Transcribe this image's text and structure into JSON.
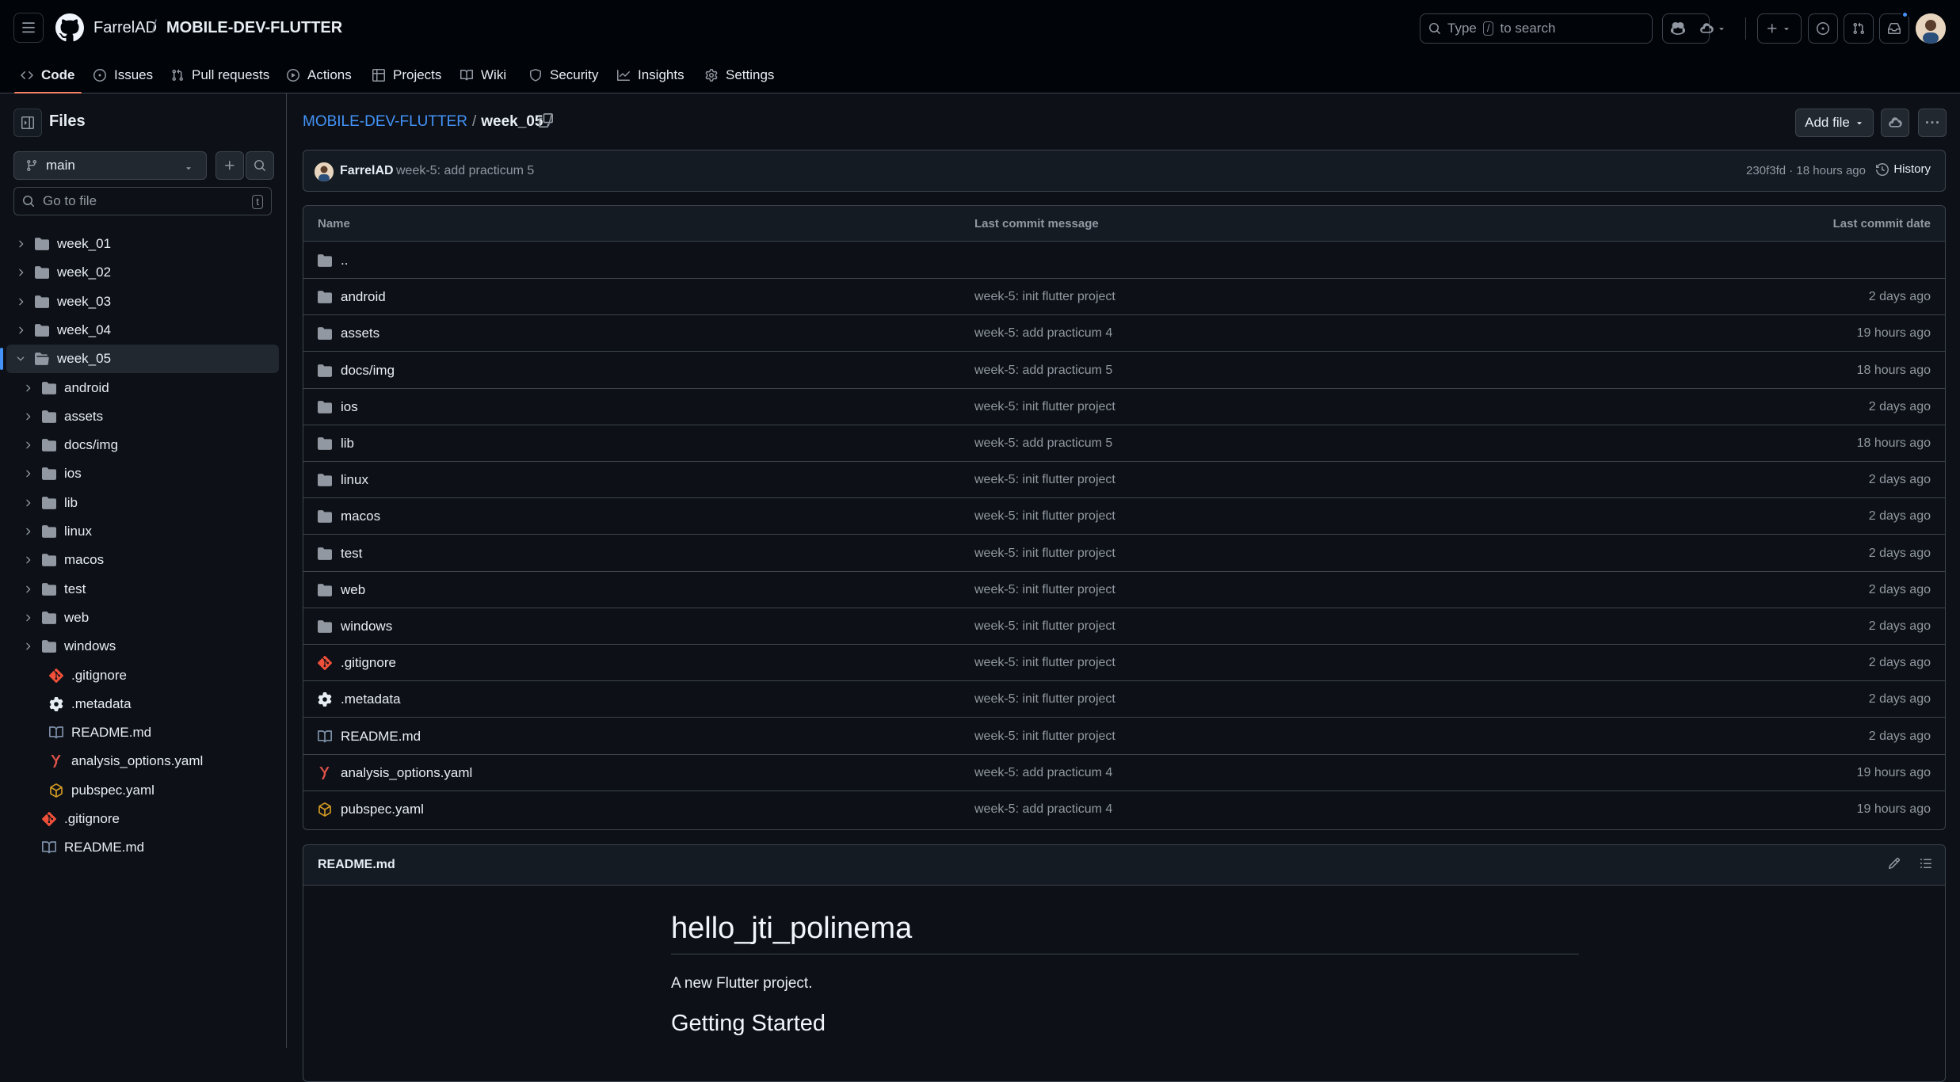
{
  "header": {
    "owner": "FarrelAD",
    "separator": "/",
    "repo": "MOBILE-DEV-FLUTTER",
    "search": {
      "prefix": "Type",
      "key": "/",
      "suffix": "to search"
    }
  },
  "tabs": [
    {
      "label": "Code",
      "icon": "code-icon",
      "active": true
    },
    {
      "label": "Issues",
      "icon": "issue-opened-icon"
    },
    {
      "label": "Pull requests",
      "icon": "git-pull-request-icon"
    },
    {
      "label": "Actions",
      "icon": "play-icon"
    },
    {
      "label": "Projects",
      "icon": "table-icon"
    },
    {
      "label": "Wiki",
      "icon": "book-icon"
    },
    {
      "label": "Security",
      "icon": "shield-icon"
    },
    {
      "label": "Insights",
      "icon": "graph-icon"
    },
    {
      "label": "Settings",
      "icon": "gear-icon"
    }
  ],
  "sidebar": {
    "title": "Files",
    "branch": "main",
    "goto_placeholder": "Go to file",
    "goto_key": "t",
    "tree": [
      {
        "label": "week_01",
        "type": "folder",
        "depth": 0
      },
      {
        "label": "week_02",
        "type": "folder",
        "depth": 0
      },
      {
        "label": "week_03",
        "type": "folder",
        "depth": 0
      },
      {
        "label": "week_04",
        "type": "folder",
        "depth": 0
      },
      {
        "label": "week_05",
        "type": "folder-open",
        "depth": 0,
        "selected": true
      },
      {
        "label": "android",
        "type": "folder",
        "depth": 1
      },
      {
        "label": "assets",
        "type": "folder",
        "depth": 1
      },
      {
        "label": "docs/img",
        "type": "folder",
        "depth": 1
      },
      {
        "label": "ios",
        "type": "folder",
        "depth": 1
      },
      {
        "label": "lib",
        "type": "folder",
        "depth": 1
      },
      {
        "label": "linux",
        "type": "folder",
        "depth": 1
      },
      {
        "label": "macos",
        "type": "folder",
        "depth": 1
      },
      {
        "label": "test",
        "type": "folder",
        "depth": 1
      },
      {
        "label": "web",
        "type": "folder",
        "depth": 1
      },
      {
        "label": "windows",
        "type": "folder",
        "depth": 1
      },
      {
        "label": ".gitignore",
        "type": "git",
        "depth": 1
      },
      {
        "label": ".metadata",
        "type": "gear",
        "depth": 1
      },
      {
        "label": "README.md",
        "type": "book",
        "depth": 1
      },
      {
        "label": "analysis_options.yaml",
        "type": "yaml",
        "depth": 1
      },
      {
        "label": "pubspec.yaml",
        "type": "package",
        "depth": 1
      },
      {
        "label": ".gitignore",
        "type": "git",
        "depth": 0
      },
      {
        "label": "README.md",
        "type": "book",
        "depth": 0
      }
    ]
  },
  "main": {
    "breadcrumb": {
      "repo": "MOBILE-DEV-FLUTTER",
      "folder": "week_05",
      "sep": "/"
    },
    "add_file": "Add file",
    "commit": {
      "author": "FarrelAD",
      "message": "week-5: add practicum 5",
      "meta": "230f3fd · 18 hours ago",
      "history": "History"
    },
    "columns": {
      "name": "Name",
      "message": "Last commit message",
      "date": "Last commit date"
    },
    "files": [
      {
        "name": "..",
        "type": "folder",
        "message": "",
        "date": ""
      },
      {
        "name": "android",
        "type": "folder",
        "message": "week-5: init flutter project",
        "date": "2 days ago"
      },
      {
        "name": "assets",
        "type": "folder",
        "message": "week-5: add practicum 4",
        "date": "19 hours ago"
      },
      {
        "name": "docs/img",
        "type": "folder",
        "message": "week-5: add practicum 5",
        "date": "18 hours ago"
      },
      {
        "name": "ios",
        "type": "folder",
        "message": "week-5: init flutter project",
        "date": "2 days ago"
      },
      {
        "name": "lib",
        "type": "folder",
        "message": "week-5: add practicum 5",
        "date": "18 hours ago"
      },
      {
        "name": "linux",
        "type": "folder",
        "message": "week-5: init flutter project",
        "date": "2 days ago"
      },
      {
        "name": "macos",
        "type": "folder",
        "message": "week-5: init flutter project",
        "date": "2 days ago"
      },
      {
        "name": "test",
        "type": "folder",
        "message": "week-5: init flutter project",
        "date": "2 days ago"
      },
      {
        "name": "web",
        "type": "folder",
        "message": "week-5: init flutter project",
        "date": "2 days ago"
      },
      {
        "name": "windows",
        "type": "folder",
        "message": "week-5: init flutter project",
        "date": "2 days ago"
      },
      {
        "name": ".gitignore",
        "type": "git",
        "message": "week-5: init flutter project",
        "date": "2 days ago"
      },
      {
        "name": ".metadata",
        "type": "gear",
        "message": "week-5: init flutter project",
        "date": "2 days ago"
      },
      {
        "name": "README.md",
        "type": "book",
        "message": "week-5: init flutter project",
        "date": "2 days ago"
      },
      {
        "name": "analysis_options.yaml",
        "type": "yaml",
        "message": "week-5: add practicum 4",
        "date": "19 hours ago"
      },
      {
        "name": "pubspec.yaml",
        "type": "package",
        "message": "week-5: add practicum 4",
        "date": "19 hours ago"
      }
    ],
    "readme": {
      "title": "README.md",
      "h1": "hello_jti_polinema",
      "p": "A new Flutter project.",
      "h2": "Getting Started"
    }
  },
  "colors": {
    "accent": "#4493f8",
    "tab_underline": "#f78166",
    "git_icon": "#f0503a",
    "yaml_icon": "#e5534b",
    "package_icon": "#d29922"
  }
}
